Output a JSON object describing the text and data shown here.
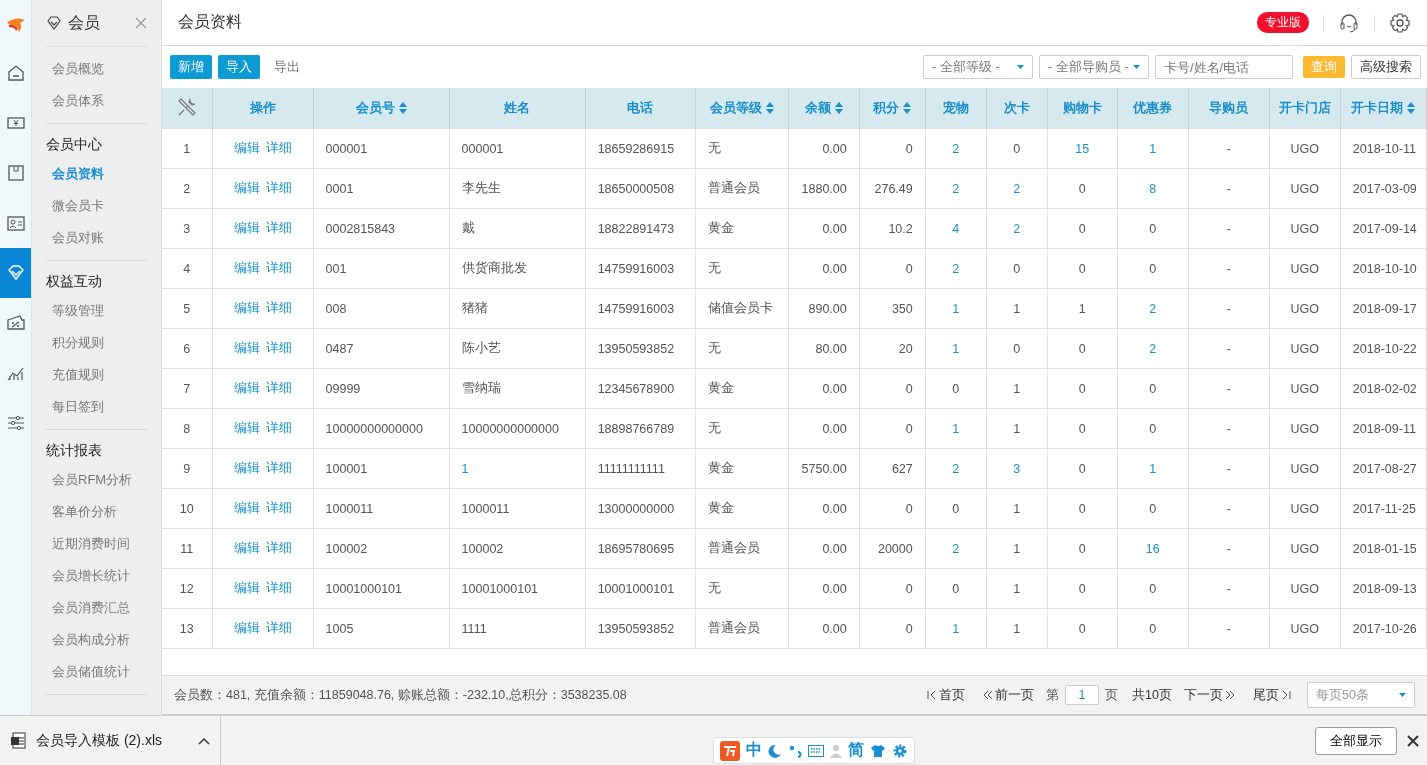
{
  "rail": [
    {
      "kind": "home",
      "selected": false
    },
    {
      "kind": "cash",
      "selected": false
    },
    {
      "kind": "box",
      "selected": false
    },
    {
      "kind": "card",
      "selected": false
    },
    {
      "kind": "diamond",
      "selected": true
    },
    {
      "kind": "ticket",
      "selected": false
    },
    {
      "kind": "chart",
      "selected": false
    },
    {
      "kind": "sliders",
      "selected": false
    }
  ],
  "submenu": {
    "title": "会员",
    "groups": [
      {
        "items": [
          {
            "label": "会员概览",
            "selected": false
          },
          {
            "label": "会员体系",
            "selected": false
          }
        ]
      },
      {
        "heading": "会员中心",
        "items": [
          {
            "label": "会员资料",
            "selected": true
          },
          {
            "label": "微会员卡",
            "selected": false
          },
          {
            "label": "会员对账",
            "selected": false
          }
        ]
      },
      {
        "heading": "权益互动",
        "items": [
          {
            "label": "等级管理",
            "selected": false
          },
          {
            "label": "积分规则",
            "selected": false
          },
          {
            "label": "充值规则",
            "selected": false
          },
          {
            "label": "每日签到",
            "selected": false
          }
        ]
      },
      {
        "heading": "统计报表",
        "items": [
          {
            "label": "会员RFM分析",
            "selected": false
          },
          {
            "label": "客单价分析",
            "selected": false
          },
          {
            "label": "近期消费时间",
            "selected": false
          },
          {
            "label": "会员增长统计",
            "selected": false
          },
          {
            "label": "会员消费汇总",
            "selected": false
          },
          {
            "label": "会员构成分析",
            "selected": false
          },
          {
            "label": "会员储值统计",
            "selected": false
          }
        ]
      }
    ]
  },
  "page_title": "会员资料",
  "edition_badge": "专业版",
  "toolbar": {
    "buttons": [
      {
        "label": "新增",
        "kind": "primary"
      },
      {
        "label": "导入",
        "kind": "primary"
      },
      {
        "label": "导出",
        "kind": "plain"
      }
    ],
    "filters": [
      {
        "value": "- 全部等级 -"
      },
      {
        "value": "- 全部导购员 -"
      }
    ],
    "search": {
      "placeholder": "卡号/姓名/电话"
    },
    "query_button": "查询",
    "advanced_button": "高级搜索"
  },
  "table": {
    "action_header": "操作",
    "columns": [
      {
        "label": "会员号",
        "sortable": true
      },
      {
        "label": "姓名",
        "sortable": false
      },
      {
        "label": "电话",
        "sortable": false
      },
      {
        "label": "会员等级",
        "sortable": true
      },
      {
        "label": "余额",
        "sortable": true
      },
      {
        "label": "积分",
        "sortable": true
      },
      {
        "label": "宠物",
        "sortable": false
      },
      {
        "label": "次卡",
        "sortable": false
      },
      {
        "label": "购物卡",
        "sortable": false
      },
      {
        "label": "优惠券",
        "sortable": false
      },
      {
        "label": "导购员",
        "sortable": false
      },
      {
        "label": "开卡门店",
        "sortable": false
      },
      {
        "label": "开卡日期",
        "sortable": true
      }
    ],
    "rows": [
      {
        "index": "1",
        "actions": [
          "编辑",
          "详细"
        ],
        "cells": [
          [
            "000001",
            false
          ],
          [
            "000001",
            false
          ],
          [
            "18659286915",
            false
          ],
          [
            "无",
            false
          ],
          [
            "0.00",
            false
          ],
          [
            "0",
            false
          ],
          [
            "2",
            true
          ],
          [
            "0",
            false
          ],
          [
            "15",
            true
          ],
          [
            "1",
            true
          ],
          [
            "-",
            false
          ],
          [
            "UGO",
            false
          ],
          [
            "2018-10-11",
            false
          ]
        ]
      },
      {
        "index": "2",
        "actions": [
          "编辑",
          "详细"
        ],
        "cells": [
          [
            "0001",
            false
          ],
          [
            "李先生",
            false
          ],
          [
            "18650000508",
            false
          ],
          [
            "普通会员",
            false
          ],
          [
            "1880.00",
            false
          ],
          [
            "276.49",
            false
          ],
          [
            "2",
            true
          ],
          [
            "2",
            true
          ],
          [
            "0",
            false
          ],
          [
            "8",
            true
          ],
          [
            "-",
            false
          ],
          [
            "UGO",
            false
          ],
          [
            "2017-03-09",
            false
          ]
        ]
      },
      {
        "index": "3",
        "actions": [
          "编辑",
          "详细"
        ],
        "cells": [
          [
            "0002815843",
            false
          ],
          [
            "戴",
            false
          ],
          [
            "18822891473",
            false
          ],
          [
            "黄金",
            false
          ],
          [
            "0.00",
            false
          ],
          [
            "10.2",
            false
          ],
          [
            "4",
            true
          ],
          [
            "2",
            true
          ],
          [
            "0",
            false
          ],
          [
            "0",
            false
          ],
          [
            "-",
            false
          ],
          [
            "UGO",
            false
          ],
          [
            "2017-09-14",
            false
          ]
        ]
      },
      {
        "index": "4",
        "actions": [
          "编辑",
          "详细"
        ],
        "cells": [
          [
            "001",
            false
          ],
          [
            "供货商批发",
            false
          ],
          [
            "14759916003",
            false
          ],
          [
            "无",
            false
          ],
          [
            "0.00",
            false
          ],
          [
            "0",
            false
          ],
          [
            "2",
            true
          ],
          [
            "0",
            false
          ],
          [
            "0",
            false
          ],
          [
            "0",
            false
          ],
          [
            "-",
            false
          ],
          [
            "UGO",
            false
          ],
          [
            "2018-10-10",
            false
          ]
        ]
      },
      {
        "index": "5",
        "actions": [
          "编辑",
          "详细"
        ],
        "cells": [
          [
            "008",
            false
          ],
          [
            "猪猪",
            false
          ],
          [
            "14759916003",
            false
          ],
          [
            "储值会员卡",
            false
          ],
          [
            "890.00",
            false
          ],
          [
            "350",
            false
          ],
          [
            "1",
            true
          ],
          [
            "1",
            false
          ],
          [
            "1",
            false
          ],
          [
            "2",
            true
          ],
          [
            "-",
            false
          ],
          [
            "UGO",
            false
          ],
          [
            "2018-09-17",
            false
          ]
        ]
      },
      {
        "index": "6",
        "actions": [
          "编辑",
          "详细"
        ],
        "cells": [
          [
            "0487",
            false
          ],
          [
            "陈小艺",
            false
          ],
          [
            "13950593852",
            false
          ],
          [
            "无",
            false
          ],
          [
            "80.00",
            false
          ],
          [
            "20",
            false
          ],
          [
            "1",
            true
          ],
          [
            "0",
            false
          ],
          [
            "0",
            false
          ],
          [
            "2",
            true
          ],
          [
            "-",
            false
          ],
          [
            "UGO",
            false
          ],
          [
            "2018-10-22",
            false
          ]
        ]
      },
      {
        "index": "7",
        "actions": [
          "编辑",
          "详细"
        ],
        "cells": [
          [
            "09999",
            false
          ],
          [
            "雪纳瑞",
            false
          ],
          [
            "12345678900",
            false
          ],
          [
            "黄金",
            false
          ],
          [
            "0.00",
            false
          ],
          [
            "0",
            false
          ],
          [
            "0",
            false
          ],
          [
            "1",
            false
          ],
          [
            "0",
            false
          ],
          [
            "0",
            false
          ],
          [
            "-",
            false
          ],
          [
            "UGO",
            false
          ],
          [
            "2018-02-02",
            false
          ]
        ]
      },
      {
        "index": "8",
        "actions": [
          "编辑",
          "详细"
        ],
        "cells": [
          [
            "10000000000000",
            false
          ],
          [
            "10000000000000",
            false
          ],
          [
            "18898766789",
            false
          ],
          [
            "无",
            false
          ],
          [
            "0.00",
            false
          ],
          [
            "0",
            false
          ],
          [
            "1",
            true
          ],
          [
            "1",
            false
          ],
          [
            "0",
            false
          ],
          [
            "0",
            false
          ],
          [
            "-",
            false
          ],
          [
            "UGO",
            false
          ],
          [
            "2018-09-11",
            false
          ]
        ]
      },
      {
        "index": "9",
        "actions": [
          "编辑",
          "详细"
        ],
        "cells": [
          [
            "100001",
            false
          ],
          [
            "1",
            true
          ],
          [
            "11111111111",
            false
          ],
          [
            "黄金",
            false
          ],
          [
            "5750.00",
            false
          ],
          [
            "627",
            false
          ],
          [
            "2",
            true
          ],
          [
            "3",
            true
          ],
          [
            "0",
            false
          ],
          [
            "1",
            true
          ],
          [
            "-",
            false
          ],
          [
            "UGO",
            false
          ],
          [
            "2017-08-27",
            false
          ]
        ]
      },
      {
        "index": "10",
        "actions": [
          "编辑",
          "详细"
        ],
        "cells": [
          [
            "1000011",
            false
          ],
          [
            "1000011",
            false
          ],
          [
            "13000000000",
            false
          ],
          [
            "黄金",
            false
          ],
          [
            "0.00",
            false
          ],
          [
            "0",
            false
          ],
          [
            "0",
            false
          ],
          [
            "1",
            false
          ],
          [
            "0",
            false
          ],
          [
            "0",
            false
          ],
          [
            "-",
            false
          ],
          [
            "UGO",
            false
          ],
          [
            "2017-11-25",
            false
          ]
        ]
      },
      {
        "index": "11",
        "actions": [
          "编辑",
          "详细"
        ],
        "cells": [
          [
            "100002",
            false
          ],
          [
            "100002",
            false
          ],
          [
            "18695780695",
            false
          ],
          [
            "普通会员",
            false
          ],
          [
            "0.00",
            false
          ],
          [
            "20000",
            false
          ],
          [
            "2",
            true
          ],
          [
            "1",
            false
          ],
          [
            "0",
            false
          ],
          [
            "16",
            true
          ],
          [
            "-",
            false
          ],
          [
            "UGO",
            false
          ],
          [
            "2018-01-15",
            false
          ]
        ]
      },
      {
        "index": "12",
        "actions": [
          "编辑",
          "详细"
        ],
        "cells": [
          [
            "10001000101",
            false
          ],
          [
            "10001000101",
            false
          ],
          [
            "10001000101",
            false
          ],
          [
            "无",
            false
          ],
          [
            "0.00",
            false
          ],
          [
            "0",
            false
          ],
          [
            "0",
            false
          ],
          [
            "1",
            false
          ],
          [
            "0",
            false
          ],
          [
            "0",
            false
          ],
          [
            "-",
            false
          ],
          [
            "UGO",
            false
          ],
          [
            "2018-09-13",
            false
          ]
        ]
      },
      {
        "index": "13",
        "actions": [
          "编辑",
          "详细"
        ],
        "cells": [
          [
            "1005",
            false
          ],
          [
            "1111",
            false
          ],
          [
            "13950593852",
            false
          ],
          [
            "普通会员",
            false
          ],
          [
            "0.00",
            false
          ],
          [
            "0",
            false
          ],
          [
            "1",
            true
          ],
          [
            "1",
            false
          ],
          [
            "0",
            false
          ],
          [
            "0",
            false
          ],
          [
            "-",
            false
          ],
          [
            "UGO",
            false
          ],
          [
            "2017-10-26",
            false
          ]
        ]
      }
    ]
  },
  "summary": "会员数：481, 充值余额：11859048.76, 赊账总额：-232.10,总积分：3538235.08",
  "pagination": {
    "first": "首页",
    "prev": "前一页",
    "page_prefix": "第",
    "page": "1",
    "page_suffix": "页",
    "total": "共10页",
    "next": "下一页",
    "last": "尾页",
    "page_size": "每页50条"
  },
  "taskbar": {
    "download": "会员导入模板 (2).xls",
    "ime": [
      "中",
      "简"
    ],
    "show_all": "全部显示"
  }
}
